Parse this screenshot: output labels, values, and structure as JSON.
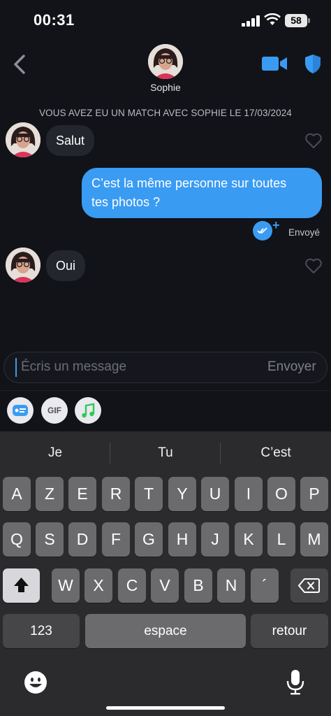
{
  "status": {
    "time": "00:31",
    "battery": "58"
  },
  "header": {
    "name": "Sophie"
  },
  "match_banner": "VOUS AVEZ EU UN MATCH AVEC SOPHIE LE 17/03/2024",
  "messages": [
    {
      "from": "Sophie",
      "text": "Salut"
    },
    {
      "from": "me",
      "text_line1": "C’est la même personne sur toutes",
      "text_line2": "tes photos ?",
      "status": "Envoyé"
    },
    {
      "from": "Sophie",
      "text": "Oui"
    }
  ],
  "composer": {
    "placeholder": "Écris un message",
    "send_label": "Envoyer"
  },
  "tools": {
    "gif_label": "GIF"
  },
  "keyboard": {
    "suggestions": [
      "Je",
      "Tu",
      "C’est"
    ],
    "row1": [
      "A",
      "Z",
      "E",
      "R",
      "T",
      "Y",
      "U",
      "I",
      "O",
      "P"
    ],
    "row2": [
      "Q",
      "S",
      "D",
      "F",
      "G",
      "H",
      "J",
      "K",
      "L",
      "M"
    ],
    "row3": [
      "W",
      "X",
      "C",
      "V",
      "B",
      "N",
      "´"
    ],
    "numbers_label": "123",
    "space_label": "espace",
    "return_label": "retour"
  },
  "colors": {
    "accent": "#3a9bf3",
    "background": "#111318",
    "bubble_in": "#23262d"
  }
}
